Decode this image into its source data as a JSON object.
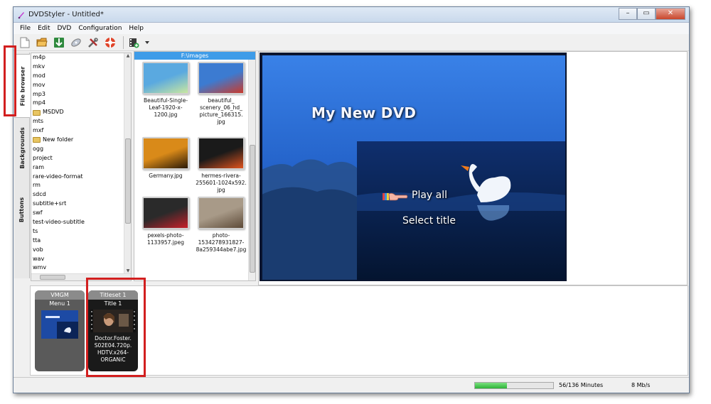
{
  "window": {
    "title": "DVDStyler - Untitled*",
    "buttons": [
      "–",
      "▭",
      "✕"
    ]
  },
  "menu": [
    "File",
    "Edit",
    "DVD",
    "Configuration",
    "Help"
  ],
  "toolbar": [
    "new-file",
    "open-folder",
    "save",
    "burn-disc",
    "settings-tools",
    "help-lifebuoy",
    "add-file"
  ],
  "side_tabs": [
    "File browser",
    "Backgrounds",
    "Buttons"
  ],
  "file_list": [
    "m4p",
    "mkv",
    "mod",
    "mov",
    "mp3",
    "mp4",
    "MSDVD",
    "mts",
    "mxf",
    "New folder",
    "ogg",
    "project",
    "ram",
    "rare-video-format",
    "rm",
    "sdcd",
    "subtitle+srt",
    "swf",
    "test-video-subtitle",
    "ts",
    "tta",
    "vob",
    "wav",
    "wmv"
  ],
  "thumbs": {
    "path": "F:\\images",
    "items": [
      {
        "label": "Beautiful-Single-\nLeaf-1920-x-\n1200.jpg",
        "colors": [
          "#5aa9e0",
          "#c9e7a0"
        ]
      },
      {
        "label": "beautiful_\nscenery_06_hd_\npicture_166315.\njpg",
        "colors": [
          "#3c7bd1",
          "#c93a2c"
        ]
      },
      {
        "label": "Germany.jpg",
        "colors": [
          "#d98a19",
          "#2a1a08"
        ]
      },
      {
        "label": "hermes-rivera-\n255601-1024x592.\njpg",
        "colors": [
          "#1a1a1a",
          "#e0531d"
        ]
      },
      {
        "label": "pexels-photo-\n1133957.jpeg",
        "colors": [
          "#2a2a2a",
          "#c8202a"
        ]
      },
      {
        "label": "photo-\n1534278931827-\n8a259344abe7.jpg",
        "colors": [
          "#a89a88",
          "#5d4a38"
        ]
      }
    ]
  },
  "preview": {
    "title": "My New DVD",
    "buttons": [
      "Play all",
      "Select title"
    ]
  },
  "timeline": {
    "vmgm": {
      "header": "VMGM",
      "sub": "Menu 1"
    },
    "titleset": {
      "header": "Titleset 1",
      "sub": "Title 1",
      "file": "Doctor.Foster.\nS02E04.720p.\nHDTV.x264-\nORGANiC"
    }
  },
  "status": {
    "progress": 0.41,
    "minutes": "56/136 Minutes",
    "bitrate": "8 Mb/s"
  },
  "colors": {
    "accent": "#3f9ce8",
    "highlight": "#d21f1f",
    "progress": "#2db338"
  }
}
